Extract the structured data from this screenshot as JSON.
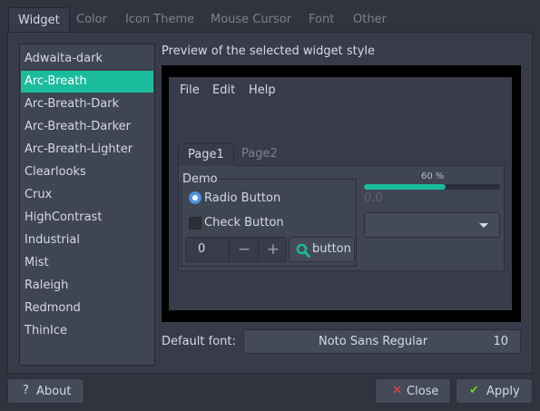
{
  "tabs": [
    "Widget",
    "Color",
    "Icon Theme",
    "Mouse Cursor",
    "Font",
    "Other"
  ],
  "themes": [
    "Adwaita-dark",
    "Arc-Breath",
    "Arc-Breath-Dark",
    "Arc-Breath-Darker",
    "Arc-Breath-Lighter",
    "Clearlooks",
    "Crux",
    "HighContrast",
    "Industrial",
    "Mist",
    "Raleigh",
    "Redmond",
    "ThinIce"
  ],
  "selected_theme": "Arc-Breath",
  "preview": {
    "caption": "Preview of the selected widget style",
    "menu": [
      "File",
      "Edit",
      "Help"
    ],
    "pages": [
      "Page1",
      "Page2"
    ],
    "group_label": "Demo",
    "radio_label": "Radio Button",
    "check_label": "Check Button",
    "spin_value": "0",
    "spin_minus": "−",
    "spin_plus": "+",
    "search_label": "button",
    "progress_text": "60 %",
    "progress_fraction": 0.6,
    "scale_value": "0.0",
    "combo_value": ""
  },
  "font": {
    "label": "Default font:",
    "name": "Noto Sans Regular",
    "size": "10"
  },
  "buttons": {
    "about": "About",
    "about_icon": "?",
    "close": "Close",
    "close_icon": "✕",
    "apply": "Apply",
    "apply_icon": "✔"
  },
  "colors": {
    "accent": "#1abc9c",
    "radio": "#5294e2",
    "close_icon": "#fc4138",
    "apply_icon": "#73d216"
  }
}
